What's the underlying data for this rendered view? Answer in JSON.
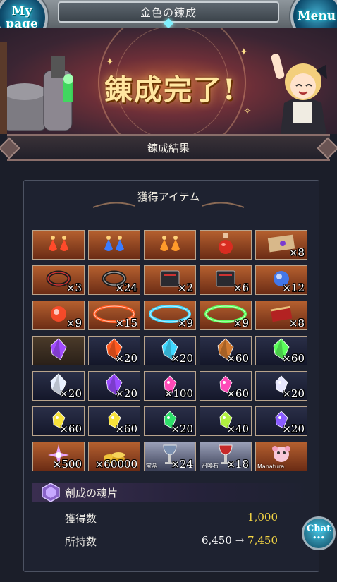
{
  "header": {
    "title": "金色の錬成",
    "mypage_line1": "My",
    "mypage_line2": "page",
    "menu_label": "Menu"
  },
  "banner": {
    "headline": "錬成完了!"
  },
  "section": {
    "title": "錬成結果"
  },
  "results": {
    "subtitle": "獲得アイテム",
    "items": [
      {
        "icon": "red-earrings-icon",
        "qty": "",
        "bg": "o"
      },
      {
        "icon": "blue-earrings-icon",
        "qty": "",
        "bg": "o"
      },
      {
        "icon": "orange-earrings-icon",
        "qty": "",
        "bg": "o"
      },
      {
        "icon": "potion-icon",
        "qty": "",
        "bg": "o"
      },
      {
        "icon": "map-icon",
        "qty": "×8",
        "bg": "o"
      },
      {
        "icon": "red-ring-icon",
        "qty": "×3",
        "bg": "o"
      },
      {
        "icon": "silver-ring-icon",
        "qty": "×24",
        "bg": "o"
      },
      {
        "icon": "tome-icon",
        "qty": "×2",
        "bg": "o"
      },
      {
        "icon": "tome-icon",
        "qty": "×6",
        "bg": "o"
      },
      {
        "icon": "blue-orb-icon",
        "qty": "×12",
        "bg": "o"
      },
      {
        "icon": "red-orb-icon",
        "qty": "×9",
        "bg": "o"
      },
      {
        "icon": "fire-halo-icon",
        "qty": "×15",
        "bg": "o"
      },
      {
        "icon": "water-halo-icon",
        "qty": "×9",
        "bg": "o"
      },
      {
        "icon": "wind-halo-icon",
        "qty": "×9",
        "bg": "o"
      },
      {
        "icon": "scroll-icon",
        "qty": "×8",
        "bg": "o"
      },
      {
        "icon": "dark-crystal-icon",
        "qty": "",
        "bg": "d"
      },
      {
        "icon": "fire-crystal-icon",
        "qty": "×20",
        "bg": "b"
      },
      {
        "icon": "water-crystal-icon",
        "qty": "×20",
        "bg": "b"
      },
      {
        "icon": "earth-crystal-icon",
        "qty": "×60",
        "bg": "b"
      },
      {
        "icon": "wind-crystal-icon",
        "qty": "×60",
        "bg": "b"
      },
      {
        "icon": "light-crystal-icon",
        "qty": "×20",
        "bg": "b"
      },
      {
        "icon": "purple-crystal-icon",
        "qty": "×20",
        "bg": "b"
      },
      {
        "icon": "pink-quartz-icon",
        "qty": "×100",
        "bg": "b"
      },
      {
        "icon": "pink-quartz-icon",
        "qty": "×60",
        "bg": "b"
      },
      {
        "icon": "white-quartz-icon",
        "qty": "×20",
        "bg": "b"
      },
      {
        "icon": "yellow-quartz-icon",
        "qty": "×60",
        "bg": "b"
      },
      {
        "icon": "yellow-quartz-icon",
        "qty": "×60",
        "bg": "b"
      },
      {
        "icon": "green-quartz-icon",
        "qty": "×20",
        "bg": "b"
      },
      {
        "icon": "lime-quartz-icon",
        "qty": "×40",
        "bg": "b"
      },
      {
        "icon": "violet-quartz-icon",
        "qty": "×20",
        "bg": "b"
      },
      {
        "icon": "sparkle-gem-icon",
        "qty": "×500",
        "bg": "o"
      },
      {
        "icon": "gold-coins-icon",
        "qty": "×60000",
        "bg": "o"
      },
      {
        "icon": "silver-chalice-icon",
        "qty": "×24",
        "bg": "s",
        "tiny": "宝晶"
      },
      {
        "icon": "red-chalice-icon",
        "qty": "×18",
        "bg": "s",
        "tiny": "召喚石"
      },
      {
        "icon": "manatura-icon",
        "qty": "",
        "bg": "o",
        "tiny": "Manatura"
      }
    ]
  },
  "souls": {
    "title": "創成の魂片",
    "obtained_label": "獲得数",
    "obtained_value": "1,000",
    "owned_label": "所持数",
    "owned_before": "6,450",
    "arrow": "→",
    "owned_after": "7,450"
  },
  "chat": {
    "label": "Chat",
    "dots": "•••"
  },
  "colors": {
    "accent_gold": "#f4d544",
    "panel_bg": "#1e2230",
    "cell_border": "#b9a48c"
  }
}
